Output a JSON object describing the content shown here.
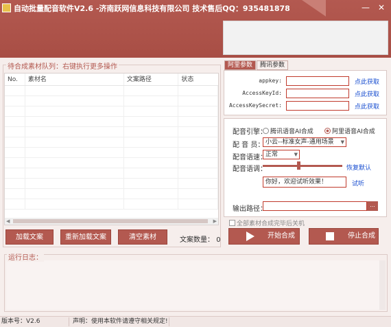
{
  "window": {
    "title": "自动批量配音软件V2.6 -济南跃网信息科技有限公司 技术售后QQ：935481878",
    "min_label": "—",
    "close_label": "✕",
    "accent": "#b35950"
  },
  "queue": {
    "group_label": "待合成素材队列：右键执行更多操作",
    "columns": [
      "No.",
      "素材名",
      "文案路径",
      "状态"
    ],
    "buttons": {
      "load": "加载文案",
      "reload": "重新加载文案",
      "clear": "清空素材"
    },
    "count_label": "文案数量：",
    "count_value": "0"
  },
  "keys": {
    "tabs": [
      "阿里参数",
      "腾讯参数"
    ],
    "fields": [
      {
        "label": "appkey:",
        "link": "点此获取"
      },
      {
        "label": "AccessKeyId:",
        "link": "点此获取"
      },
      {
        "label": "AccessKeySecret:",
        "link": "点此获取"
      }
    ]
  },
  "config": {
    "engine_label": "配音引擎：",
    "engine_options": [
      "腾讯语音AI合成",
      "阿里语音AI合成"
    ],
    "engine_selected": 1,
    "voice_label": "配 音 员：",
    "voice_value": "小云--标准女声-通用场景",
    "speed_label": "配音语速：",
    "speed_value": "正常",
    "tone_label": "配音语调：",
    "tone_level": 0.45,
    "reset_link": "恢复默认",
    "test_text": "你好，欢迎试听效果！",
    "test_link": "试听",
    "output_label": "输出路径：",
    "browse_label": "...",
    "shutdown_label": "全部素材合成完毕后关机"
  },
  "actions": {
    "start": "开始合成",
    "stop": "停止合成"
  },
  "log": {
    "label": "运行日志："
  },
  "status": {
    "version": "版本号：V2.6",
    "notice": "声明：使用本软件请遵守相关规定!"
  }
}
